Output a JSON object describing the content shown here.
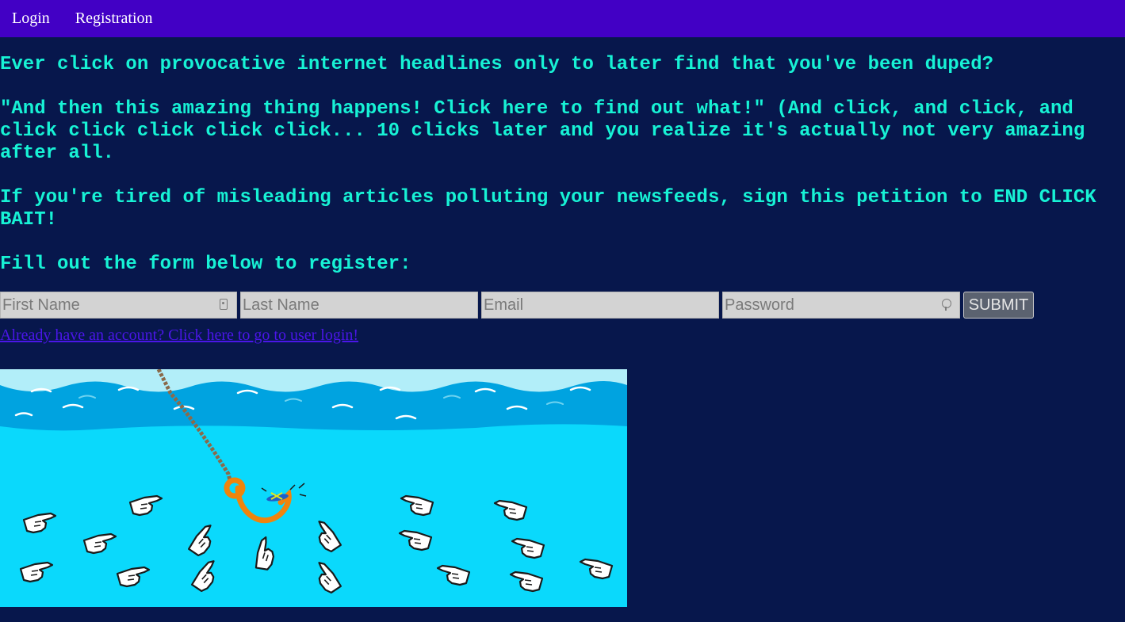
{
  "nav": {
    "login": "Login",
    "registration": "Registration"
  },
  "main": {
    "intro_question": "Ever click on provocative internet headlines only to later find that you've been duped?",
    "quote": "\"And then this amazing thing happens! Click here to find out what!\" (And click, and click, and click click click click click... 10 clicks later and you realize it's actually not very amazing after all.",
    "petition": "If you're tired of misleading articles polluting your newsfeeds, sign this petition to END CLICK BAIT!",
    "form_prompt": "Fill out the form below to register:"
  },
  "form": {
    "first_name_placeholder": "First Name",
    "last_name_placeholder": "Last Name",
    "email_placeholder": "Email",
    "password_placeholder": "Password",
    "submit_label": "SUBMIT"
  },
  "login_link": "Already have an account? Click here to go to user login!",
  "colors": {
    "background": "#07174c",
    "navbar": "#4200c5",
    "headline_text": "#17f2d5",
    "link": "#4a16e8",
    "water_light": "#0ad9fc",
    "water_dark": "#00a3e0",
    "sky": "#b2eef9",
    "hook": "#f0840c"
  },
  "illustration": {
    "icon": "fishing-hook-cursor-illustration"
  }
}
